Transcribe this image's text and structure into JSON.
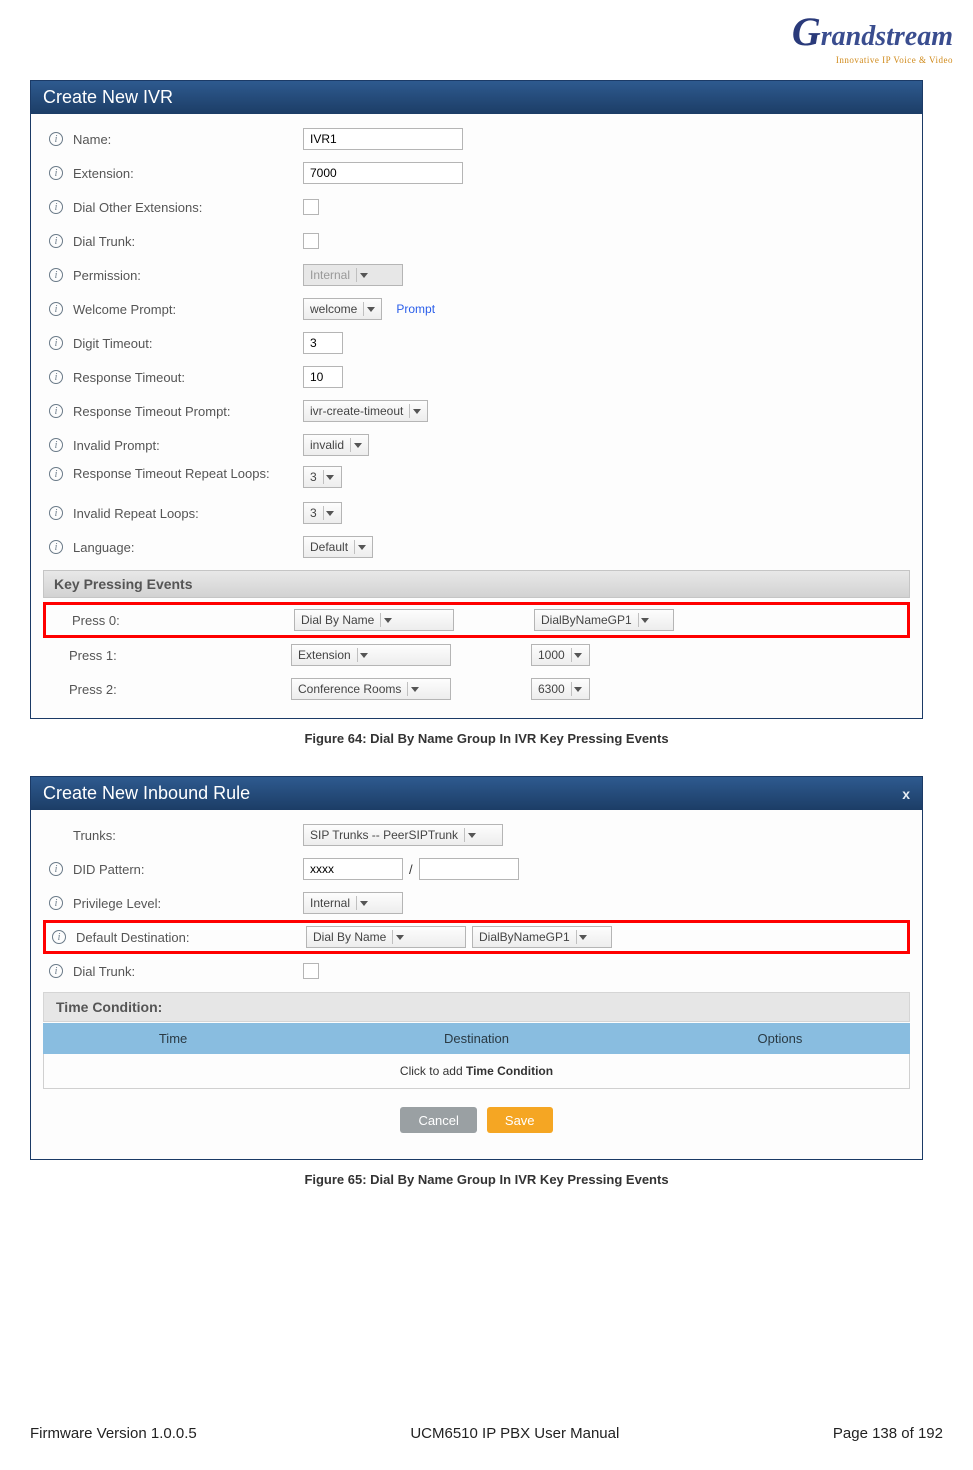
{
  "logo": {
    "brand_prefix": "G",
    "brand_rest": "randstream",
    "tagline": "Innovative IP Voice & Video"
  },
  "panel1": {
    "title": "Create New IVR",
    "fields": {
      "name": {
        "label": "Name:",
        "value": "IVR1"
      },
      "extension": {
        "label": "Extension:",
        "value": "7000"
      },
      "dial_other": {
        "label": "Dial Other Extensions:"
      },
      "dial_trunk": {
        "label": "Dial Trunk:"
      },
      "permission": {
        "label": "Permission:",
        "value": "Internal"
      },
      "welcome": {
        "label": "Welcome Prompt:",
        "value": "welcome",
        "link": "Prompt"
      },
      "digit_timeout": {
        "label": "Digit Timeout:",
        "value": "3"
      },
      "response_timeout": {
        "label": "Response Timeout:",
        "value": "10"
      },
      "response_prompt": {
        "label": "Response Timeout Prompt:",
        "value": "ivr-create-timeout"
      },
      "invalid_prompt": {
        "label": "Invalid Prompt:",
        "value": "invalid"
      },
      "response_loops": {
        "label": "Response Timeout Repeat Loops:",
        "value": "3"
      },
      "invalid_loops": {
        "label": "Invalid Repeat Loops:",
        "value": "3"
      },
      "language": {
        "label": "Language:",
        "value": "Default"
      }
    },
    "key_section_title": "Key Pressing Events",
    "keys": [
      {
        "label": "Press 0:",
        "sel1": "Dial By Name",
        "sel2": "DialByNameGP1",
        "highlight": true
      },
      {
        "label": "Press 1:",
        "sel1": "Extension",
        "sel2": "1000",
        "highlight": false
      },
      {
        "label": "Press 2:",
        "sel1": "Conference Rooms",
        "sel2": "6300",
        "highlight": false
      }
    ]
  },
  "caption1": "Figure 64: Dial By Name Group In IVR Key Pressing Events",
  "panel2": {
    "title": "Create New Inbound Rule",
    "close": "x",
    "fields": {
      "trunks": {
        "label": "Trunks:",
        "value": "SIP Trunks -- PeerSIPTrunk"
      },
      "did": {
        "label": "DID Pattern:",
        "value": "xxxx",
        "slash": "/"
      },
      "privilege": {
        "label": "Privilege Level:",
        "value": "Internal"
      },
      "default_dest": {
        "label": "Default Destination:",
        "sel1": "Dial By Name",
        "sel2": "DialByNameGP1"
      },
      "dial_trunk": {
        "label": "Dial Trunk:"
      }
    },
    "cond_title": "Time Condition:",
    "cond_head": {
      "c1": "Time",
      "c2": "Destination",
      "c3": "Options"
    },
    "cond_body_prefix": "Click to add ",
    "cond_body_bold": "Time Condition",
    "btn_cancel": "Cancel",
    "btn_save": "Save"
  },
  "caption2": "Figure 65: Dial By Name Group In IVR Key Pressing Events",
  "footer": {
    "left": "Firmware Version 1.0.0.5",
    "center": "UCM6510 IP PBX User Manual",
    "right": "Page 138 of 192"
  }
}
